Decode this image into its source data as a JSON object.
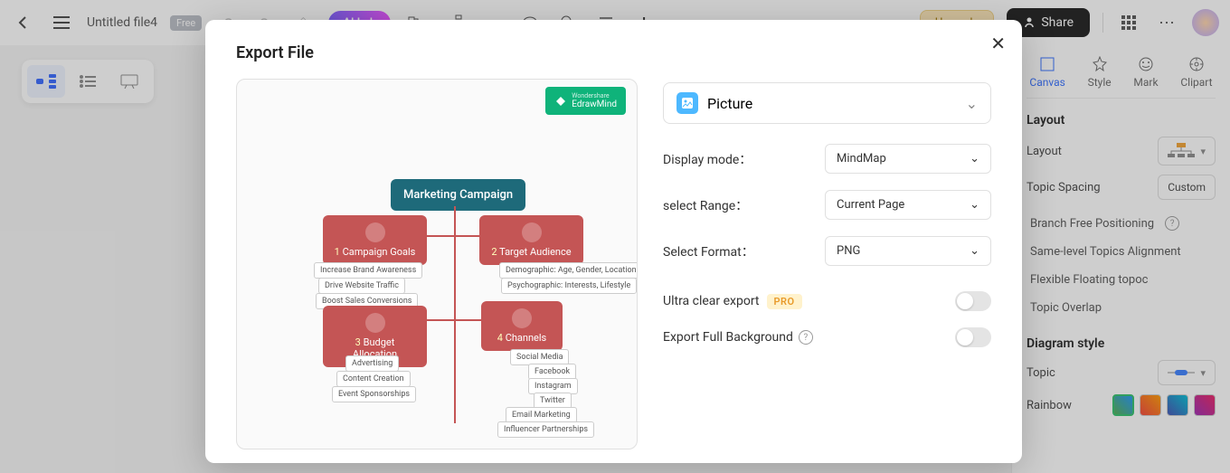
{
  "header": {
    "filename": "Untitled file4",
    "badge": "Free",
    "ai_label": "AI Lab",
    "upgrade": "Upgrade",
    "share": "Share"
  },
  "right_panel": {
    "tabs": [
      "Canvas",
      "Style",
      "Mark",
      "Clipart"
    ],
    "layout_title": "Layout",
    "layout_label": "Layout",
    "spacing_label": "Topic Spacing",
    "spacing_value": "Custom",
    "items": [
      "Branch Free Positioning",
      "Same-level Topics Alignment",
      "Flexible Floating topoc",
      "Topic Overlap"
    ],
    "diagram_title": "Diagram style",
    "topic_label": "Topic",
    "rainbow_label": "Rainbow"
  },
  "modal": {
    "title": "Export File",
    "type_label": "Picture",
    "display_mode_label": "Display mode：",
    "display_mode_value": "MindMap",
    "range_label": "select Range：",
    "range_value": "Current Page",
    "format_label": "Select Format：",
    "format_value": "PNG",
    "ultra_label": "Ultra clear export",
    "pro": "PRO",
    "bg_label": "Export Full Background",
    "edraw_brand_top": "Wondershare",
    "edraw_brand": "EdrawMind"
  },
  "preview_map": {
    "root": "Marketing Campaign",
    "n1": "Campaign Goals",
    "n1_subs": [
      "Increase Brand Awareness",
      "Drive Website Traffic",
      "Boost Sales Conversions"
    ],
    "n2": "Target Audience",
    "n2_subs": [
      "Demographic: Age, Gender, Location",
      "Psychographic: Interests, Lifestyle"
    ],
    "n3": "Budget Allocation",
    "n3_subs": [
      "Advertising",
      "Content Creation",
      "Event Sponsorships"
    ],
    "n4": "Channels",
    "n4_subs": [
      "Social Media",
      "Facebook",
      "Instagram",
      "Twitter",
      "Email Marketing",
      "Influencer Partnerships"
    ]
  }
}
